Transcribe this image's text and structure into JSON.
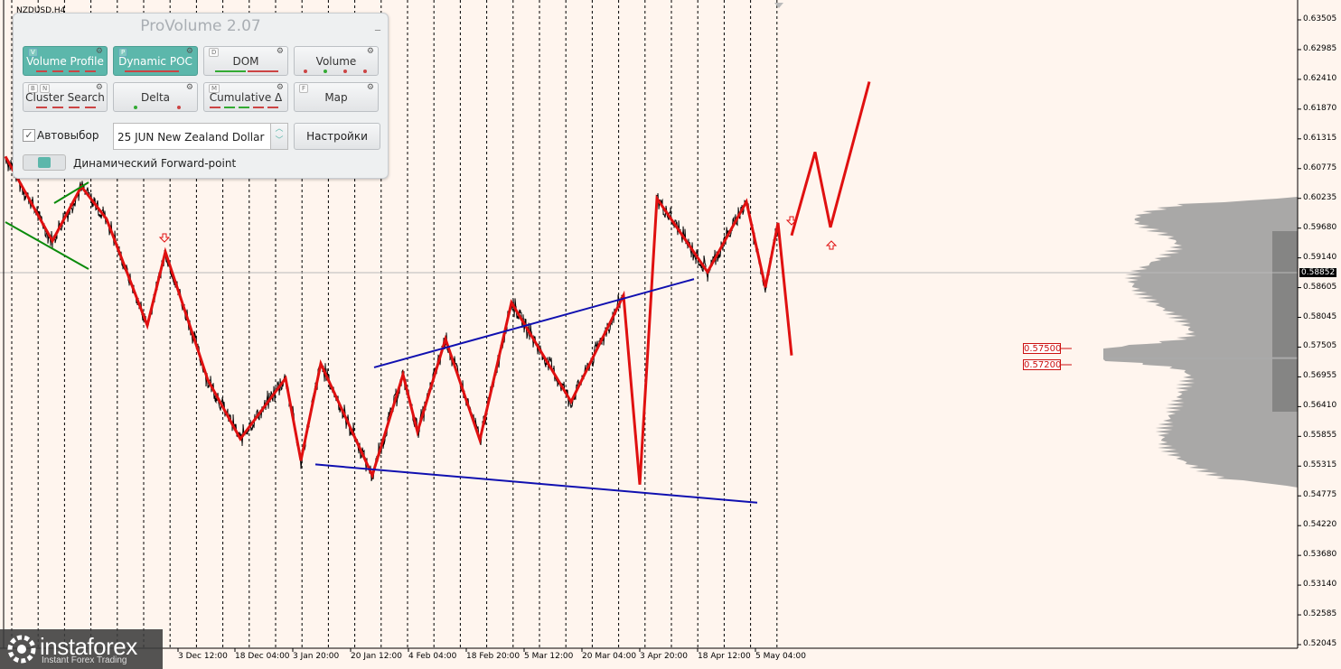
{
  "symbol": "NZDUSD,H4",
  "panel": {
    "title": "ProVolume 2.07",
    "buttons": [
      {
        "label": "Volume Profile",
        "key": "V",
        "active": true
      },
      {
        "label": "Dynamic POC",
        "key": "P",
        "active": true
      },
      {
        "label": "DOM",
        "key": "D",
        "active": false
      },
      {
        "label": "Volume",
        "key": "",
        "active": false
      },
      {
        "label": "Cluster Search",
        "key": "B",
        "key2": "N",
        "active": false
      },
      {
        "label": "Delta",
        "key": "",
        "active": false
      },
      {
        "label": "Cumulative Δ",
        "key": "M",
        "active": false
      },
      {
        "label": "Map",
        "key": "F",
        "active": false
      }
    ],
    "autoselect_label": "Автовыбор",
    "contract": "25 JUN New Zealand Dollar",
    "settings_label": "Настройки",
    "forward_point_label": "Динамический Forward-point"
  },
  "chart_data": {
    "type": "line",
    "title": "NZDUSD,H4",
    "x_tick_labels": [
      "3 Dec 12:00",
      "18 Dec 04:00",
      "3 Jan 20:00",
      "20 Jan 12:00",
      "4 Feb 04:00",
      "18 Feb 20:00",
      "5 Mar 12:00",
      "20 Mar 04:00",
      "3 Apr 20:00",
      "18 Apr 12:00",
      "5 May 04:00"
    ],
    "y_tick_labels": [
      "0.63505",
      "0.62985",
      "0.62410",
      "0.61870",
      "0.61315",
      "0.60775",
      "0.60235",
      "0.59680",
      "0.59140",
      "0.58605",
      "0.58045",
      "0.57505",
      "0.56955",
      "0.56410",
      "0.55855",
      "0.55315",
      "0.54775",
      "0.54220",
      "0.53680",
      "0.53140",
      "0.52585",
      "0.52045"
    ],
    "ylim": [
      0.5193,
      0.6365
    ],
    "current_price": "0.58852",
    "levels": [
      "0.57500",
      "0.57200"
    ],
    "zigzag_prices": [
      0.61,
      0.5945,
      0.6045,
      0.5985,
      0.579,
      0.5925,
      0.569,
      0.5582,
      0.5693,
      0.5542,
      0.572,
      0.5515,
      0.57,
      0.5595,
      0.5765,
      0.558,
      0.5832,
      0.565,
      0.5845,
      0.5498,
      0.6023,
      0.5888,
      0.6017,
      0.586,
      0.5978,
      0.5735
    ],
    "forecast_up_prices": [
      0.5955,
      0.6108,
      0.597,
      0.6237
    ],
    "channel_upper": [
      [
        0.5713
      ],
      [
        0.5875
      ]
    ],
    "channel_lower": [
      [
        0.5535
      ],
      [
        0.5465
      ]
    ],
    "volume_profile_poc": "0.5730"
  },
  "logo": {
    "name": "instaforex",
    "sub": "Instant Forex Trading"
  },
  "colors": {
    "zigzag": "#e01010",
    "channel": "#1010b0",
    "wedge": "#0a8a0a",
    "background": "#fff5ee"
  }
}
